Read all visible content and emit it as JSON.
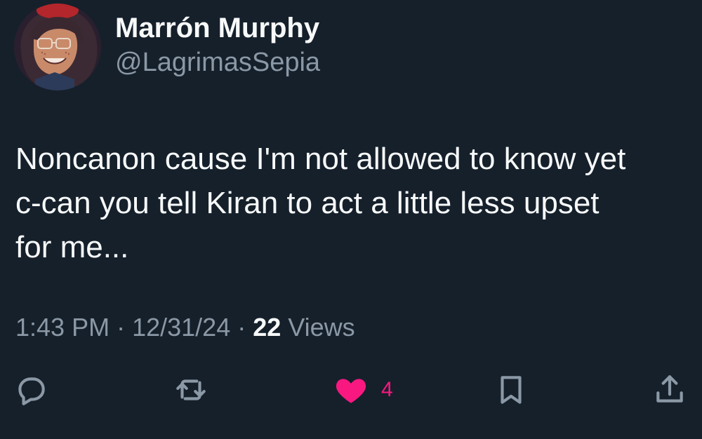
{
  "user": {
    "display_name": "Marrón Murphy",
    "handle": "@LagrimasSepia"
  },
  "tweet": {
    "text": "Noncanon cause I'm not allowed to know yet\nc-can you tell Kiran to act a little less upset\nfor me...",
    "time": "1:43 PM",
    "date": "12/31/24",
    "separator": "·",
    "views_count": "22",
    "views_label": "Views"
  },
  "actions": {
    "reply_icon": "reply-icon",
    "repost_icon": "repost-icon",
    "like_icon": "heart-filled-icon",
    "like_count": "4",
    "bookmark_icon": "bookmark-icon",
    "share_icon": "share-icon"
  },
  "colors": {
    "background": "#15202b",
    "text_primary": "#f7f9f9",
    "text_secondary": "#8b98a5",
    "like_pink": "#f91880",
    "like_fill": "#f91880"
  }
}
